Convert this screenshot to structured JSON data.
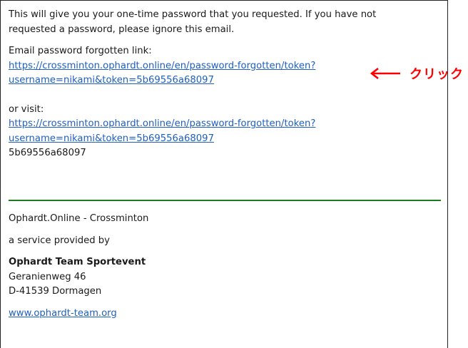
{
  "email": {
    "intro_line1": "This will give you your one-time password that you requested. If you have not",
    "intro_line2": "requested a password, please ignore this email.",
    "forgotten_label": "Email password forgotten link:",
    "forgotten_link_line1": "https://crossminton.ophardt.online/en/password-forgotten/token?",
    "forgotten_link_line2": "username=nikami&token=5b69556a68097",
    "visit_label": "or visit:",
    "visit_link_line1": "https://crossminton.ophardt.online/en/password-forgotten/token?",
    "visit_link_line2": "username=nikami&token=5b69556a68097",
    "token": "5b69556a68097"
  },
  "footer": {
    "site_name": "Ophardt.Online - Crossminton",
    "service_text": "a service provided by",
    "company": "Ophardt Team Sportevent",
    "street": "Geranienweg 46",
    "city": "D-41539 Dormagen",
    "website": "www.ophardt-team.org"
  },
  "annotation": {
    "label": "クリック",
    "color": "#ff0000",
    "icon": "left-arrow-icon"
  }
}
